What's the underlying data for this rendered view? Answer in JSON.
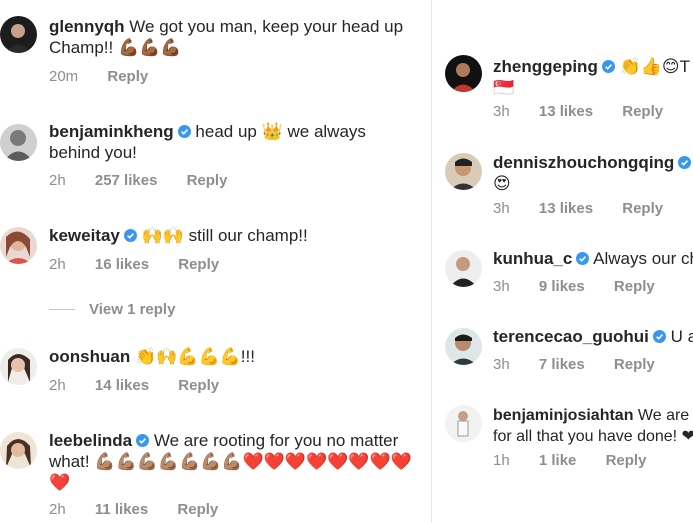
{
  "left": [
    {
      "username": "glennyqh",
      "verified": false,
      "text": "We got you man, keep your head up Champ!! 💪🏾💪🏾💪🏾",
      "time": "20m",
      "likes": "",
      "reply": "Reply"
    },
    {
      "username": "benjaminkheng",
      "verified": true,
      "text": "head up 👑 we always behind you!",
      "time": "2h",
      "likes": "257 likes",
      "reply": "Reply"
    },
    {
      "username": "keweitay",
      "verified": true,
      "text": "🙌🙌 still our champ!!",
      "time": "2h",
      "likes": "16 likes",
      "reply": "Reply",
      "view_replies": "View 1 reply"
    },
    {
      "username": "oonshuan",
      "verified": false,
      "text": "👏🙌💪💪💪!!!",
      "time": "2h",
      "likes": "14 likes",
      "reply": "Reply"
    },
    {
      "username": "leebelinda",
      "verified": true,
      "text": "We are rooting for you no matter what! 💪🏽💪🏽💪🏽💪🏽💪🏽💪🏽💪🏽❤️❤️❤️❤️❤️❤️❤️❤️❤️",
      "time": "2h",
      "likes": "11 likes",
      "reply": "Reply"
    }
  ],
  "right": [
    {
      "username": "zhenggeping",
      "verified": true,
      "text": "👏👍😊T",
      "line2": "🇸🇬",
      "time": "3h",
      "likes": "13 likes",
      "reply": "Reply"
    },
    {
      "username": "denniszhouchongqing",
      "verified": true,
      "text": "W",
      "line2": "😍",
      "time": "3h",
      "likes": "13 likes",
      "reply": "Reply"
    },
    {
      "username": "kunhua_c",
      "verified": true,
      "text": "Always our ch",
      "time": "3h",
      "likes": "9 likes",
      "reply": "Reply"
    },
    {
      "username": "terencecao_guohui",
      "verified": true,
      "text": "U ar",
      "time": "3h",
      "likes": "7 likes",
      "reply": "Reply"
    },
    {
      "username": "benjaminjosiahtan",
      "verified": false,
      "text": "We are",
      "line2": "for all that you have done! ❤",
      "time": "1h",
      "likes": "1 like",
      "reply": "Reply"
    }
  ],
  "colors": {
    "verified": "#3897f0",
    "meta": "#8e8e8e",
    "text": "#262626"
  },
  "icons": {
    "verified": "verified-badge-icon"
  }
}
